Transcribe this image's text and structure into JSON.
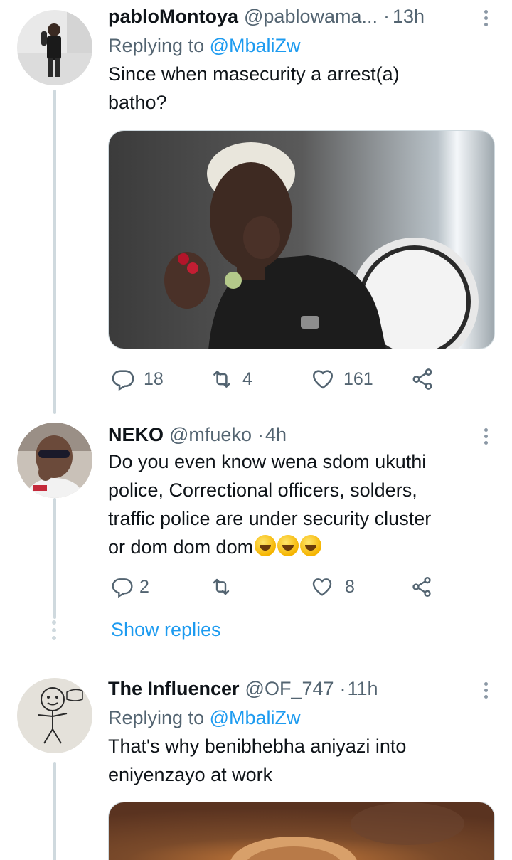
{
  "tweets": [
    {
      "name": "pabloMontoya",
      "handle": "@pablowama...",
      "dot": "·",
      "time": "13h",
      "replying_prefix": "Replying to ",
      "replying_to": "@MbaliZw",
      "text_lines": [
        "Since when masecurity a arrest(a)",
        "batho?"
      ],
      "replies": "18",
      "retweets": "4",
      "likes": "161"
    },
    {
      "name": "NEKO",
      "handle": "@mfueko",
      "dot": "·",
      "time": "4h",
      "text_lines": [
        "Do you even know wena sdom ukuthi",
        "police, Correctional officers, solders,",
        "traffic police are under security cluster",
        "or dom dom dom"
      ],
      "replies": "2",
      "retweets": "",
      "likes": "8",
      "show_replies": "Show replies"
    },
    {
      "name": "The Influencer",
      "handle": "@OF_747",
      "dot": "·",
      "time": "11h",
      "replying_prefix": "Replying to ",
      "replying_to": "@MbaliZw",
      "text_lines": [
        "That's why benibhebha aniyazi into",
        "eniyenzayo at work"
      ]
    }
  ],
  "icons": {
    "reply": "reply-icon",
    "retweet": "retweet-icon",
    "like": "heart-icon",
    "share": "share-icon",
    "more": "more-options-icon",
    "emoji": "rolling-on-floor-laughing-emoji"
  },
  "colors": {
    "link": "#1d9bf0",
    "secondary_text": "#536471",
    "primary_text": "#0f1419",
    "thread_line": "#cfd9de"
  }
}
